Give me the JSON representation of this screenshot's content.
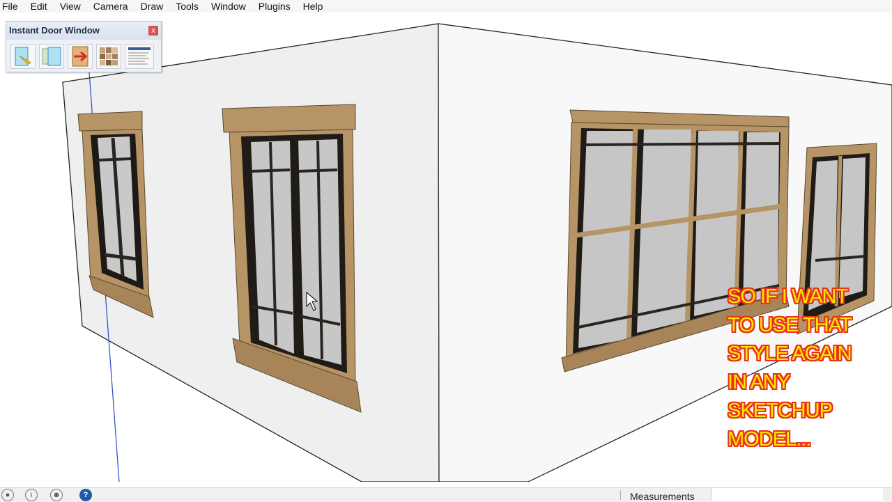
{
  "menu": {
    "items": [
      "File",
      "Edit",
      "View",
      "Camera",
      "Draw",
      "Tools",
      "Window",
      "Plugins",
      "Help"
    ]
  },
  "toolbar": {
    "title": "Instant Door Window",
    "close_label": "x",
    "icons": [
      "door-window-place-icon",
      "copy-window-icon",
      "move-door-icon",
      "material-grid-icon",
      "settings-list-icon"
    ]
  },
  "caption": {
    "lines": [
      "SO IF I WANT",
      "TO USE THAT",
      "STYLE AGAIN",
      "IN ANY",
      "SKETCHUP",
      "MODEL..."
    ]
  },
  "status": {
    "measurements_label": "Measurements",
    "measurements_value": "",
    "help_label": "?"
  },
  "colors": {
    "frame_wood": "#b69466",
    "frame_dark": "#3f3320",
    "caption_text": "#ffe600",
    "caption_outline": "#e8311a",
    "axis_blue": "#2b49c8"
  }
}
